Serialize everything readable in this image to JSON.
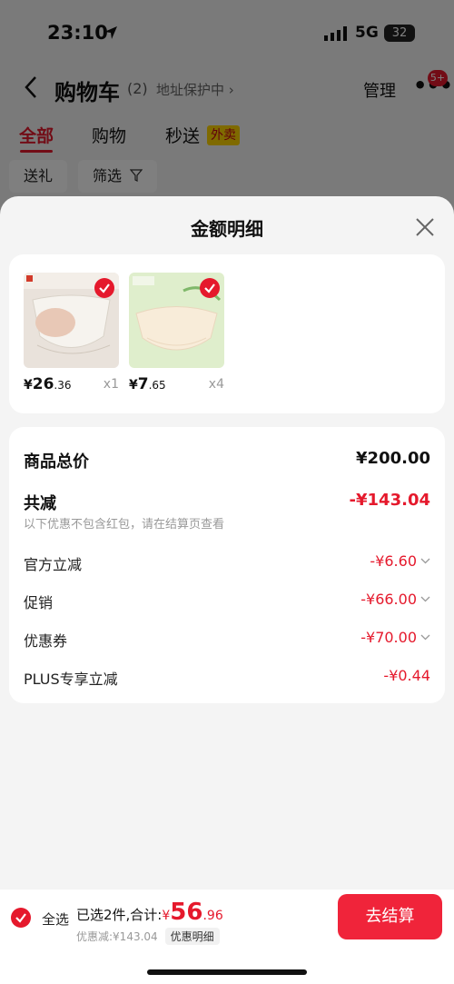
{
  "status_bar": {
    "time": "23:10",
    "network": "5G",
    "battery": "32"
  },
  "nav": {
    "title": "购物车",
    "count": "(2)",
    "address_protect": "地址保护中",
    "manage": "管理",
    "more": "•••",
    "badge": "5+"
  },
  "tabs": [
    {
      "label": "全部",
      "active": true
    },
    {
      "label": "购物"
    },
    {
      "label": "秒送"
    }
  ],
  "tab_tag": "外卖",
  "chips": [
    {
      "label": "送礼"
    },
    {
      "label": "筛选"
    }
  ],
  "sheet": {
    "title": "金额明细",
    "products": [
      {
        "price_symbol": "¥",
        "price_int": "26",
        "price_dec": ".36",
        "qty": "x1",
        "thumb_color": "#e9e2db",
        "selected": true
      },
      {
        "price_symbol": "¥",
        "price_int": "7",
        "price_dec": ".65",
        "qty": "x4",
        "thumb_color": "#dfeecc",
        "selected": true
      }
    ],
    "total_label": "商品总价",
    "total_value": "¥200.00",
    "reduce_label": "共减",
    "reduce_value": "-¥143.04",
    "reduce_note": "以下优惠不包含红包，请在结算页查看",
    "items": [
      {
        "label": "官方立减",
        "value": "-¥6.60",
        "expandable": true
      },
      {
        "label": "促销",
        "value": "-¥66.00",
        "expandable": true
      },
      {
        "label": "优惠券",
        "value": "-¥70.00",
        "expandable": true
      },
      {
        "label": "PLUS专享立减",
        "value": "-¥0.44",
        "expandable": false
      }
    ]
  },
  "bottom": {
    "select_all": "全选",
    "selected_text": "已选2件,合计:",
    "total_symbol": "¥",
    "total_int": "56",
    "total_dec": ".96",
    "discount_text": "优惠减:¥143.04",
    "discount_detail": "优惠明细",
    "checkout": "去结算"
  },
  "colors": {
    "accent": "#e5192c",
    "checkout": "#f0243a",
    "takeout_tag": "#ffd500"
  }
}
